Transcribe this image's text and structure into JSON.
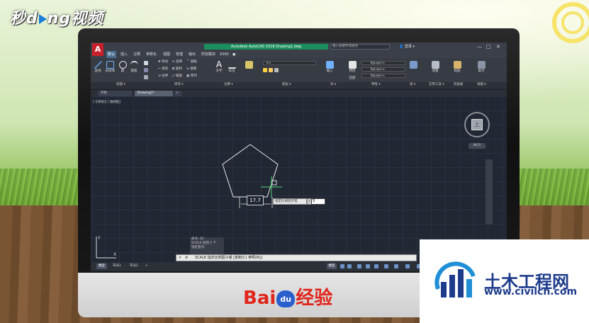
{
  "watermark_top": {
    "brand_part1": "秒",
    "brand_part2": "d",
    "brand_part3": "ng视频"
  },
  "app": {
    "logo_letter": "A",
    "window_title": "Autodesk AutoCAD 2018    Drawing1.dwg",
    "search_placeholder": "键入关键字或短语",
    "login_label": "登录",
    "window_controls": [
      "—",
      "□",
      "✕"
    ]
  },
  "menu": {
    "items": [
      "默认",
      "插入",
      "注释",
      "参数化",
      "视图",
      "管理",
      "输出",
      "附加模块",
      "A360",
      "●"
    ]
  },
  "ribbon": {
    "draw_tools": [
      "直线",
      "多段线",
      "圆",
      "圆弧"
    ],
    "modify_tools": [
      "移动",
      "旋转",
      "修剪",
      "复制",
      "镜像",
      "圆角",
      "拉伸",
      "缩放",
      "阵列"
    ],
    "annotation_tools": [
      "文字",
      "标注"
    ],
    "layer_value": "0",
    "insert_label": "插入",
    "properties_labels": [
      "特性",
      "匹配"
    ],
    "bylayer_values": [
      "ByLayer",
      "ByLayer",
      "ByLayer"
    ],
    "group_label": "组",
    "utility_label": "实用工具",
    "measure_label": "测量",
    "paste_label": "粘贴",
    "base_label": "基点",
    "panel_labels": [
      "绘图",
      "修改",
      "注释",
      "图层",
      "块",
      "特性",
      "组",
      "实用工具",
      "剪贴板",
      "视图"
    ]
  },
  "file_tabs": [
    "开始",
    "Drawing1*",
    "+"
  ],
  "viewport": {
    "label": "[-][俯视][二维线框]",
    "viewcube_face": "上",
    "wcs_label": "WCS",
    "dimension_value": "17.7",
    "tooltip_text": "指定比例因子或",
    "tooltip_button": "↓",
    "input_value": "5"
  },
  "command": {
    "history": [
      "命令: SC",
      "SCALE 找到 1 个",
      "指定基点:"
    ],
    "prompt": "SCALE 指定比例因子或 [复制(C) 参照(R)]:",
    "close_icon_text": "✕",
    "wrench_icon_text": "⚙"
  },
  "status": {
    "layout_tabs": [
      "模型",
      "布局1",
      "布局2",
      "+"
    ],
    "model_label": "模型"
  },
  "watermark": {
    "title": "土木工程网",
    "url": "www.civilcn.com"
  },
  "monitor_brand": {
    "bai": "Bai",
    "du": "du",
    "jingyan": "经验"
  }
}
